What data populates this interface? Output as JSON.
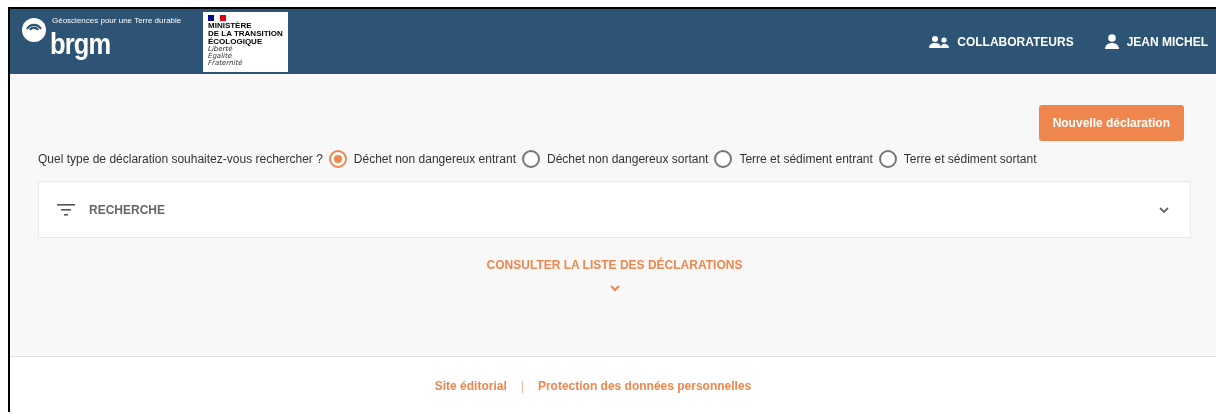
{
  "header": {
    "tagline": "Géosciences pour une Terre durable",
    "logo_text": "brgm",
    "ministry": {
      "lines": [
        "MINISTÈRE",
        "DE LA TRANSITION",
        "ÉCOLOGIQUE"
      ],
      "motto": [
        "Liberté",
        "Égalité",
        "Fraternité"
      ]
    },
    "nav": [
      {
        "label": "COLLABORATEURS",
        "kind": "team"
      },
      {
        "label": "JEAN MICHEL",
        "kind": "user"
      }
    ]
  },
  "new_button": "Nouvelle déclaration",
  "question": "Quel type de déclaration souhaitez-vous rechercher ?",
  "types": [
    {
      "label": "Déchet non dangereux entrant",
      "selected": true
    },
    {
      "label": "Déchet non dangereux sortant",
      "selected": false
    },
    {
      "label": "Terre et sédiment entrant",
      "selected": false
    },
    {
      "label": "Terre et sédiment sortant",
      "selected": false
    }
  ],
  "search_panel": {
    "title": "RECHERCHE",
    "expanded": false
  },
  "list_link": "CONSULTER LA LISTE DES DÉCLARATIONS",
  "footer": {
    "links": [
      "Site éditorial",
      "Protection des données personnelles"
    ],
    "separator": "|"
  }
}
